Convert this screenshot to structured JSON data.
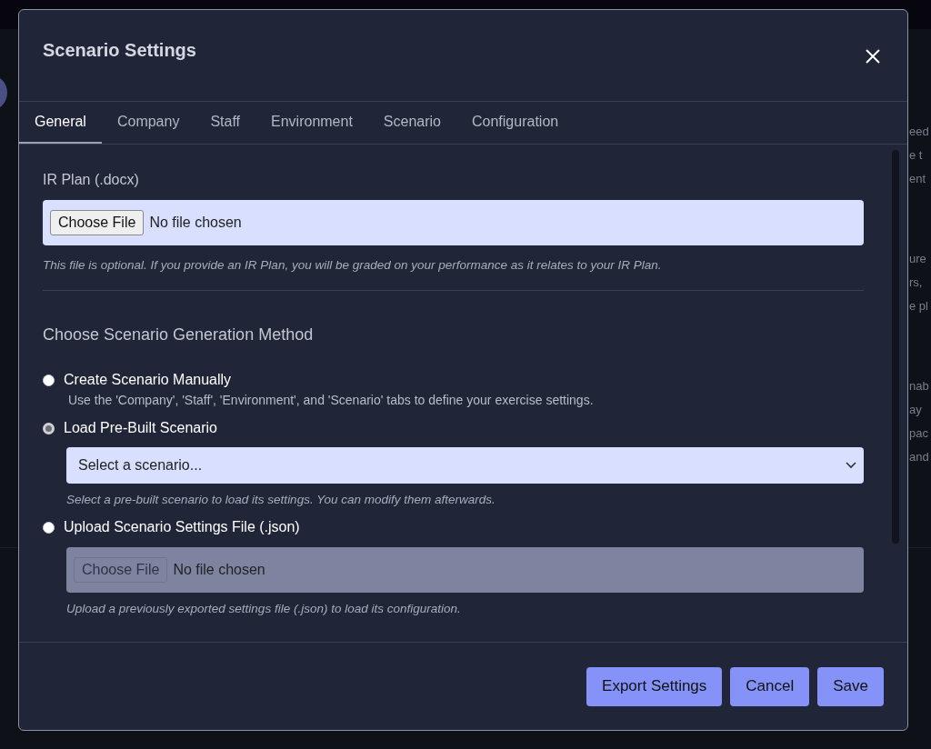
{
  "background": {
    "paragraphs": [
      [
        "eed",
        "e t",
        "ent"
      ],
      [
        "ure",
        "rs,",
        "e pl"
      ],
      [
        "nab",
        "ay",
        "pac",
        "and"
      ]
    ]
  },
  "dialog": {
    "title": "Scenario Settings",
    "tabs": [
      {
        "label": "General",
        "selected": true
      },
      {
        "label": "Company",
        "selected": false
      },
      {
        "label": "Staff",
        "selected": false
      },
      {
        "label": "Environment",
        "selected": false
      },
      {
        "label": "Scenario",
        "selected": false
      },
      {
        "label": "Configuration",
        "selected": false
      }
    ],
    "ir_plan": {
      "label": "IR Plan (.docx)",
      "button": "Choose File",
      "value": "No file chosen",
      "disabled": false,
      "hint": "This file is optional. If you provide an IR Plan, you will be graded on your performance as it relates to your IR Plan."
    },
    "method": {
      "heading": "Choose Scenario Generation Method",
      "options": [
        {
          "kind": "text",
          "label": "Create Scenario Manually",
          "selected": false,
          "description": "Use the 'Company', 'Staff', 'Environment', and 'Scenario' tabs to define your exercise settings."
        },
        {
          "kind": "select",
          "label": "Load Pre-Built Scenario",
          "selected": true,
          "value": "Select a scenario...",
          "hint": "Select a pre-built scenario to load its settings. You can modify them afterwards."
        },
        {
          "kind": "file",
          "label": "Upload Scenario Settings File (.json)",
          "selected": false,
          "button": "Choose File",
          "value": "No file chosen",
          "disabled": true,
          "hint": "Upload a previously exported settings file (.json) to load its configuration."
        }
      ]
    },
    "buttons": [
      "Export Settings",
      "Cancel",
      "Save"
    ]
  }
}
